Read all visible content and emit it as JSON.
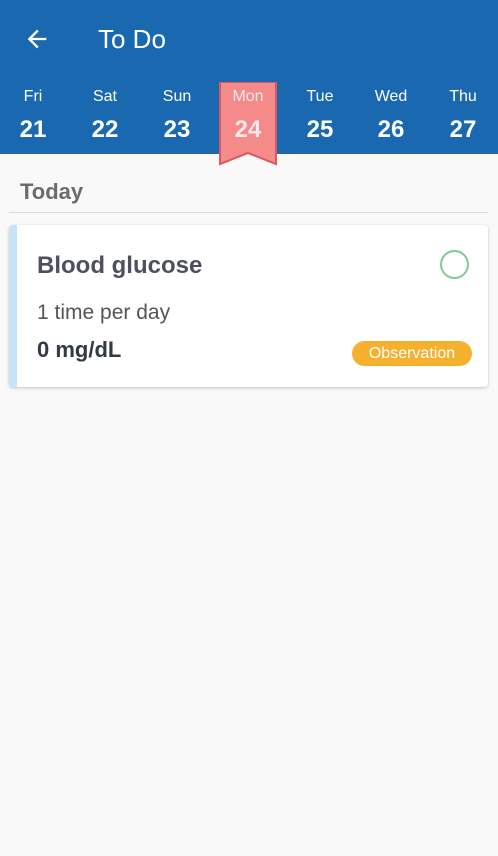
{
  "header": {
    "title": "To Do",
    "background_color": "#1a69b0",
    "back_icon": "arrow-left-icon"
  },
  "week": {
    "days": [
      {
        "name": "Fri",
        "num": "21"
      },
      {
        "name": "Sat",
        "num": "22"
      },
      {
        "name": "Sun",
        "num": "23"
      },
      {
        "name": "Mon",
        "num": "24"
      },
      {
        "name": "Tue",
        "num": "25"
      },
      {
        "name": "Wed",
        "num": "26"
      },
      {
        "name": "Thu",
        "num": "27"
      }
    ],
    "selected_index": 3,
    "selected_color": "#f48a8a"
  },
  "section": {
    "title": "Today"
  },
  "task": {
    "title": "Blood glucose",
    "frequency": "1 time per day",
    "value": "0 mg/dL",
    "badge": "Observation",
    "badge_color": "#f5b02e",
    "accent_color": "#c8e2f8",
    "check_icon": "circle-outline-icon",
    "check_color": "#7ecb94"
  }
}
